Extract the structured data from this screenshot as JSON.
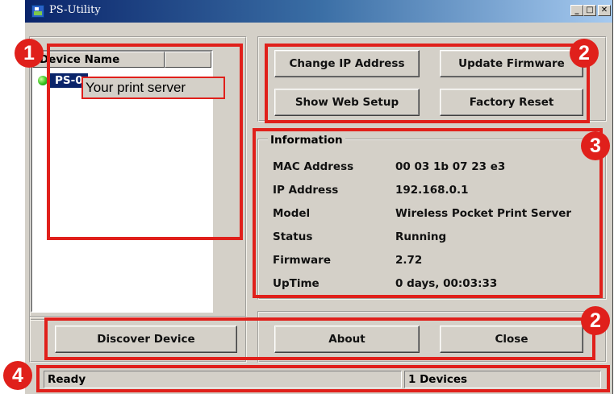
{
  "window": {
    "title": "PS-Utility",
    "minimize": "_",
    "maximize": "□",
    "close": "✕"
  },
  "device_list": {
    "columns": [
      "Device Name",
      ""
    ],
    "items": [
      {
        "name": "PS-0",
        "status": "online"
      }
    ]
  },
  "tooltip": "Your print server",
  "buttons": {
    "change_ip": "Change IP Address",
    "update_firmware": "Update Firmware",
    "show_web_setup": "Show Web Setup",
    "factory_reset": "Factory Reset",
    "discover_device": "Discover Device",
    "about": "About",
    "close": "Close"
  },
  "information": {
    "title": "Information",
    "rows": [
      {
        "label": "MAC Address",
        "value": "00 03 1b 07 23 e3"
      },
      {
        "label": "IP Address",
        "value": "192.168.0.1"
      },
      {
        "label": "Model",
        "value": "Wireless Pocket Print Server"
      },
      {
        "label": "Status",
        "value": "Running"
      },
      {
        "label": "Firmware",
        "value": "2.72"
      },
      {
        "label": "UpTime",
        "value": "0 days, 00:03:33"
      }
    ]
  },
  "status_bar": {
    "left": "Ready",
    "right": "1 Devices"
  },
  "callouts": [
    "1",
    "2",
    "3",
    "2",
    "4"
  ],
  "colors": {
    "annotation_red": "#e0201b",
    "selection": "#0a246a",
    "online": "#35c11e"
  }
}
